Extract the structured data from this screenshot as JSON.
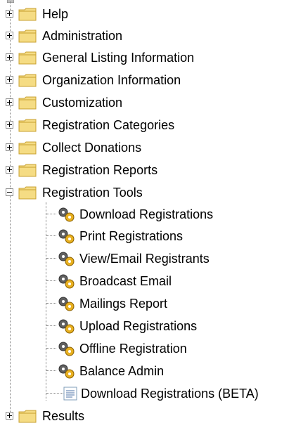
{
  "tree": {
    "top_items": [
      {
        "label": "Help",
        "expander": "plus"
      },
      {
        "label": "Administration",
        "expander": "plus"
      },
      {
        "label": "General Listing Information",
        "expander": "plus"
      },
      {
        "label": "Organization Information",
        "expander": "plus"
      },
      {
        "label": "Customization",
        "expander": "plus"
      },
      {
        "label": "Registration Categories",
        "expander": "plus"
      },
      {
        "label": "Collect Donations",
        "expander": "plus"
      },
      {
        "label": "Registration Reports",
        "expander": "plus"
      },
      {
        "label": "Registration Tools",
        "expander": "minus"
      }
    ],
    "tool_items": [
      {
        "label": "Download Registrations",
        "icon": "gears-icon"
      },
      {
        "label": "Print Registrations",
        "icon": "gears-icon"
      },
      {
        "label": "View/Email Registrants",
        "icon": "gears-icon"
      },
      {
        "label": "Broadcast Email",
        "icon": "gears-icon"
      },
      {
        "label": "Mailings Report",
        "icon": "gears-icon"
      },
      {
        "label": "Upload Registrations",
        "icon": "gears-icon"
      },
      {
        "label": "Offline Registration",
        "icon": "gears-icon"
      },
      {
        "label": "Balance Admin",
        "icon": "gears-icon"
      },
      {
        "label": "Download Registrations (BETA)",
        "icon": "document-icon"
      }
    ],
    "last_item": {
      "label": "Results",
      "expander": "plus"
    },
    "colors": {
      "folder_fill": "#f5dc84",
      "folder_edge": "#c8a030",
      "gear_dark": "#404040",
      "gear_gold": "#e8b020",
      "line": "#808080"
    }
  }
}
